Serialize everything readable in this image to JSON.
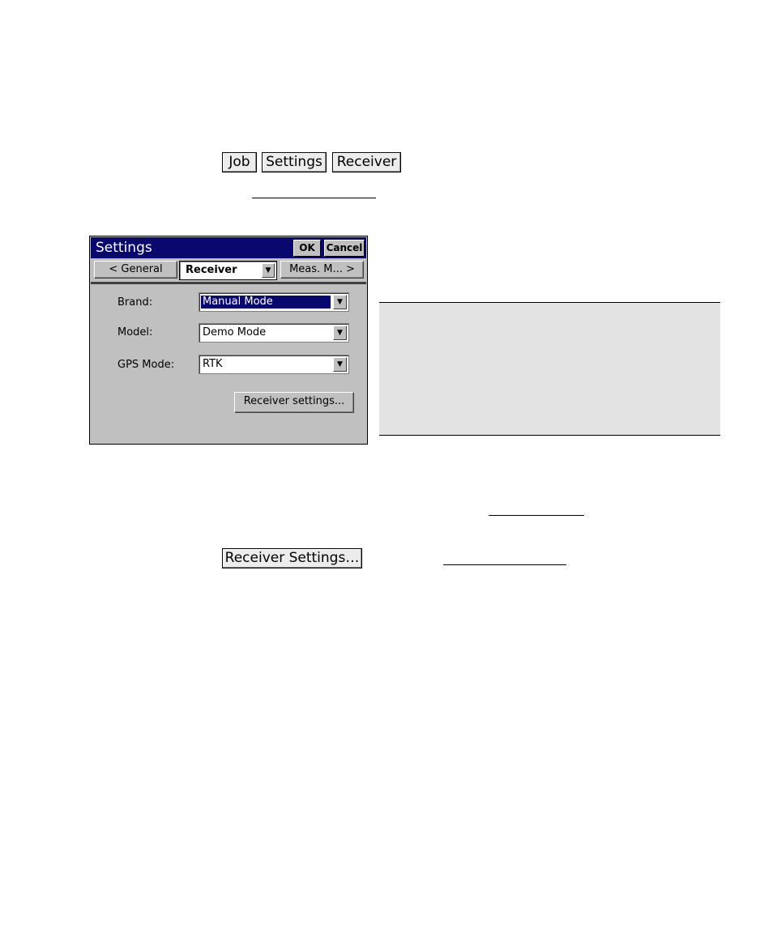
{
  "menu_path": {
    "job": "Job",
    "settings": "Settings",
    "receiver": "Receiver"
  },
  "dialog": {
    "title": "Settings",
    "ok": "OK",
    "cancel": "Cancel",
    "tab_prev": "< General",
    "tab_current": "Receiver",
    "tab_next": "Meas. M... >",
    "fields": {
      "brand_label": "Brand:",
      "brand_value": "Manual Mode",
      "model_label": "Model:",
      "model_value": "Demo Mode",
      "gps_mode_label": "GPS Mode:",
      "gps_mode_value": "RTK"
    },
    "receiver_settings_button": "Receiver settings..."
  },
  "receiver_settings_key": "Receiver Settings…",
  "icons": {
    "dropdown": "chevron-down-icon"
  },
  "colors": {
    "titlebar": "#08086e",
    "dialog_bg": "#c0c0c0",
    "note_bg": "#e3e3e3"
  }
}
